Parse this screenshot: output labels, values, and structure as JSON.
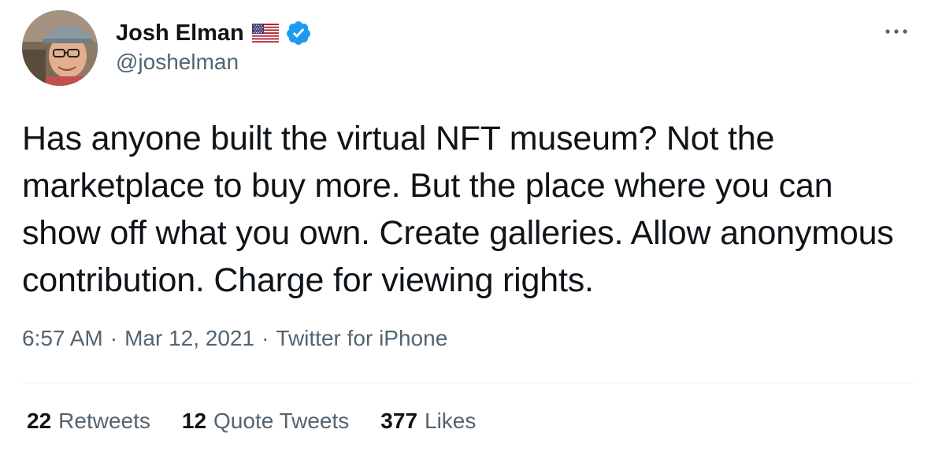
{
  "author": {
    "display_name": "Josh Elman",
    "handle": "@joshelman",
    "flag_icon": "us-flag-icon",
    "verified_icon": "verified-badge-icon",
    "verified_color": "#1d9bf0"
  },
  "tweet": {
    "text": "Has anyone built the virtual NFT museum? Not the marketplace to buy more. But the place where you can show off what you own. Create galleries. Allow anonymous contribution. Charge for viewing rights."
  },
  "meta": {
    "time": "6:57 AM",
    "separator": "·",
    "date": "Mar 12, 2021",
    "source": "Twitter for iPhone"
  },
  "stats": {
    "retweets_count": "22",
    "retweets_label": "Retweets",
    "quotes_count": "12",
    "quotes_label": "Quote Tweets",
    "likes_count": "377",
    "likes_label": "Likes"
  },
  "colors": {
    "text_primary": "#0f1419",
    "text_secondary": "#536471",
    "divider": "#e6ecf0"
  },
  "more_icon": "more-dots-icon"
}
